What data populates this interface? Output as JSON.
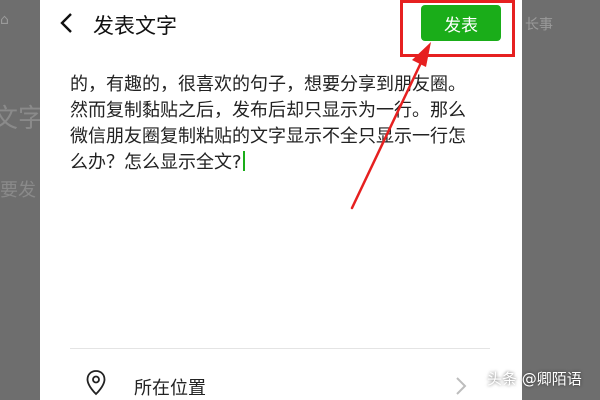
{
  "background": {
    "left_title": "文字",
    "left_sub": "要发",
    "right_tab": "长事"
  },
  "header": {
    "title": "发表文字",
    "publish_label": "发表"
  },
  "post": {
    "text": "的，有趣的，很喜欢的句子，想要分享到朋友圈。然而复制黏贴之后，发布后却只显示为一行。那么微信朋友圈复制粘贴的文字显示不全只显示一行怎么办？怎么显示全文?"
  },
  "location": {
    "label": "所在位置"
  },
  "watermark": {
    "text": "头条 @卿陌语"
  },
  "colors": {
    "publish_green": "#1aad19",
    "annotation_red": "#e62020",
    "cursor_green": "#1aad19"
  }
}
